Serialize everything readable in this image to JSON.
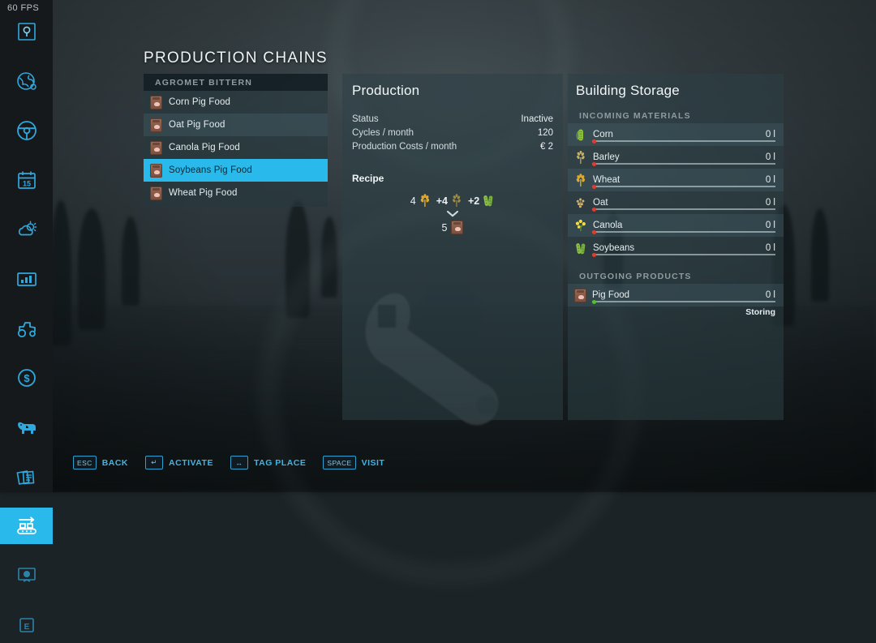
{
  "hud": {
    "fps": "60 FPS"
  },
  "sidebar": {
    "items": [
      {
        "name": "sidebar-item-quests",
        "icon": "quest-marker-icon",
        "active": false
      },
      {
        "name": "sidebar-item-map",
        "icon": "globe-map-icon",
        "active": false
      },
      {
        "name": "sidebar-item-vehicles",
        "icon": "steering-wheel-icon",
        "active": false
      },
      {
        "name": "sidebar-item-calendar",
        "icon": "calendar-15-icon",
        "active": false
      },
      {
        "name": "sidebar-item-weather",
        "icon": "sun-cloud-icon",
        "active": false
      },
      {
        "name": "sidebar-item-statistics",
        "icon": "bar-chart-icon",
        "active": false
      },
      {
        "name": "sidebar-item-machines",
        "icon": "tractor-icon",
        "active": false
      },
      {
        "name": "sidebar-item-finances",
        "icon": "dollar-coin-icon",
        "active": false
      },
      {
        "name": "sidebar-item-animals",
        "icon": "cow-icon",
        "active": false
      },
      {
        "name": "sidebar-item-contracts",
        "icon": "documents-icon",
        "active": false
      },
      {
        "name": "sidebar-item-production",
        "icon": "conveyor-belt-icon",
        "active": true
      },
      {
        "name": "sidebar-item-presentation",
        "icon": "presentation-icon",
        "active": false
      },
      {
        "name": "sidebar-item-settings",
        "icon": "e-key-icon",
        "active": false
      }
    ]
  },
  "page": {
    "title": "PRODUCTION CHAINS"
  },
  "chain_list": {
    "header": "AGROMET BITTERN",
    "rows": [
      {
        "label": "Corn Pig Food",
        "icon": "pig-food-sack-icon",
        "selected": false
      },
      {
        "label": "Oat Pig Food",
        "icon": "pig-food-sack-icon",
        "selected": false
      },
      {
        "label": "Canola Pig Food",
        "icon": "pig-food-sack-icon",
        "selected": false
      },
      {
        "label": "Soybeans Pig Food",
        "icon": "pig-food-sack-icon",
        "selected": true
      },
      {
        "label": "Wheat Pig Food",
        "icon": "pig-food-sack-icon",
        "selected": false
      }
    ]
  },
  "production": {
    "title": "Production",
    "stats": [
      {
        "label": "Status",
        "value": "Inactive"
      },
      {
        "label": "Cycles / month",
        "value": "120"
      },
      {
        "label": "Production Costs / month",
        "value": "€ 2"
      }
    ],
    "recipe_title": "Recipe",
    "recipe": {
      "inputs": [
        {
          "amount": "4",
          "icon": "wheat-icon",
          "sep": ""
        },
        {
          "amount": "+4",
          "icon": "oat-icon",
          "sep": "+"
        },
        {
          "amount": "+2",
          "icon": "soybeans-icon",
          "sep": "+"
        }
      ],
      "arrow": "chevron-down-icon",
      "output": {
        "amount": "5",
        "icon": "pig-food-sack-icon"
      }
    }
  },
  "storage": {
    "title": "Building Storage",
    "incoming_header": "INCOMING MATERIALS",
    "incoming": [
      {
        "name": "Corn",
        "icon": "corn-icon",
        "amount": "0 l",
        "fill_status": "empty"
      },
      {
        "name": "Barley",
        "icon": "barley-icon",
        "amount": "0 l",
        "fill_status": "empty"
      },
      {
        "name": "Wheat",
        "icon": "wheat-icon",
        "amount": "0 l",
        "fill_status": "empty"
      },
      {
        "name": "Oat",
        "icon": "oat-icon",
        "amount": "0 l",
        "fill_status": "empty"
      },
      {
        "name": "Canola",
        "icon": "canola-icon",
        "amount": "0 l",
        "fill_status": "empty"
      },
      {
        "name": "Soybeans",
        "icon": "soybeans-icon",
        "amount": "0 l",
        "fill_status": "empty"
      }
    ],
    "outgoing_header": "OUTGOING PRODUCTS",
    "outgoing": [
      {
        "name": "Pig Food",
        "icon": "pig-food-sack-icon",
        "amount": "0 l",
        "fill_status": "storing",
        "status_text": "Storing"
      }
    ]
  },
  "helpbar": [
    {
      "key": "ESC",
      "label": "BACK",
      "wide": false
    },
    {
      "key": "↵",
      "label": "ACTIVATE",
      "wide": false
    },
    {
      "key": "↔",
      "label": "TAG PLACE",
      "wide": false
    },
    {
      "key": "SPACE",
      "label": "VISIT",
      "wide": true
    }
  ],
  "colors": {
    "accent": "#29b9ea",
    "help_text": "#43b3e3",
    "panel": "#2b3f46",
    "dot_empty": "#e33b2e",
    "dot_storing": "#4fc12a"
  }
}
